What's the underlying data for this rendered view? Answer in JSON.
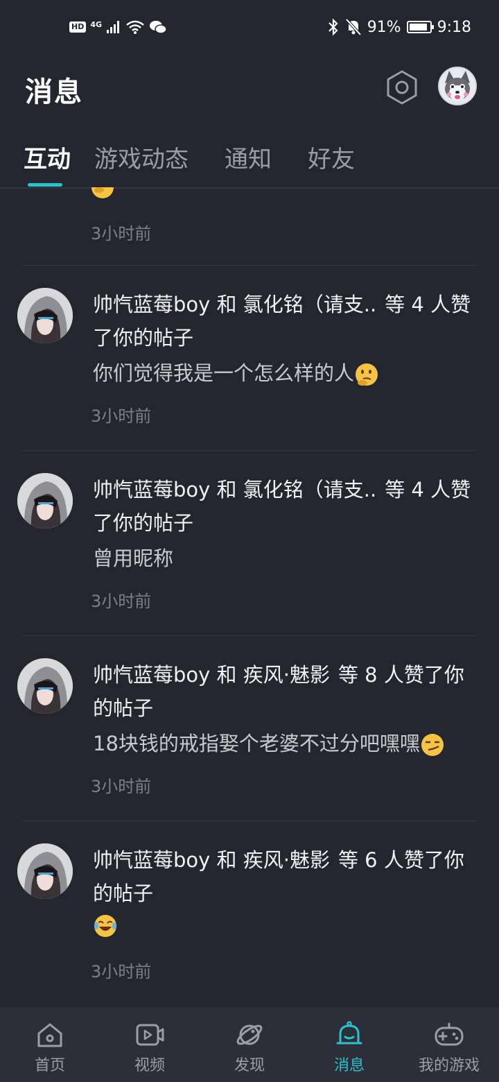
{
  "status_bar": {
    "hd": "HD",
    "network": "4G",
    "battery_percent": "91%",
    "battery_level": 0.91,
    "time": "9:18"
  },
  "header": {
    "title": "消息"
  },
  "tabs": [
    {
      "label": "互动",
      "active": true
    },
    {
      "label": "游戏动态",
      "active": false
    },
    {
      "label": "通知",
      "active": false
    },
    {
      "label": "好友",
      "active": false
    }
  ],
  "partial_item": {
    "time": "3小时前"
  },
  "items": [
    {
      "names": "帅忾蓝莓boy 和 氯化铭（请支..",
      "count_text": "等 4 人赞了你的帖子",
      "content": "你们觉得我是一个怎么样的人",
      "emoji": "thinking-face",
      "time": "3小时前"
    },
    {
      "names": "帅忾蓝莓boy 和 氯化铭（请支..",
      "count_text": "等 4 人赞了你的帖子",
      "content": "曾用昵称",
      "emoji": "",
      "time": "3小时前"
    },
    {
      "names": "帅忾蓝莓boy 和 疾风·魅影",
      "count_text": "等 8 人赞了你的帖子",
      "content": "18块钱的戒指娶个老婆不过分吧嘿嘿",
      "emoji": "smirking-face",
      "time": "3小时前"
    },
    {
      "names": "帅忾蓝莓boy 和 疾风·魅影",
      "count_text": "等 6 人赞了你的帖子",
      "content": "",
      "emoji": "tears-of-joy-face",
      "time": "3小时前"
    }
  ],
  "bottom_nav": [
    {
      "label": "首页",
      "icon": "home-icon",
      "active": false
    },
    {
      "label": "视频",
      "icon": "video-icon",
      "active": false
    },
    {
      "label": "发现",
      "icon": "planet-icon",
      "active": false
    },
    {
      "label": "消息",
      "icon": "bell-icon",
      "active": true
    },
    {
      "label": "我的游戏",
      "icon": "gamepad-icon",
      "active": false
    }
  ],
  "colors": {
    "background": "#23252f",
    "accent": "#27c4c9",
    "nav_background": "#2c2f3a"
  }
}
